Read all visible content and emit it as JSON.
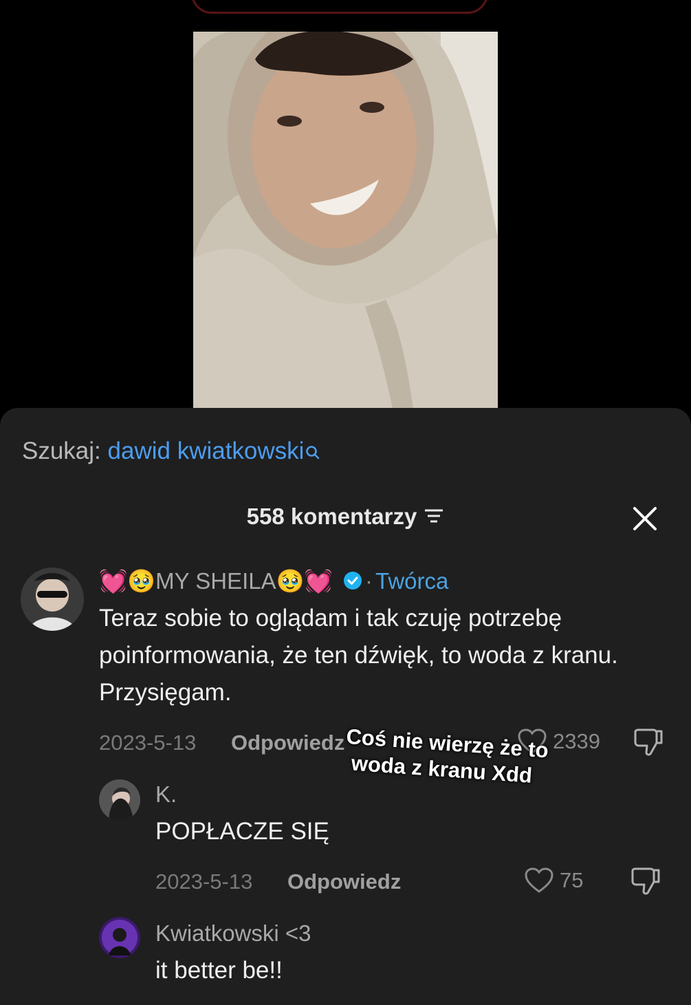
{
  "search": {
    "prefix": "Szukaj:",
    "query": "dawid kwiatkowski"
  },
  "comments_header": {
    "count_label": "558 komentarzy"
  },
  "overlay": {
    "line1": "Coś nie wierzę że to",
    "line2": "woda z kranu Xdd"
  },
  "comments": [
    {
      "username": "💓🥹MY SHEILA🥹💓",
      "creator_label": "Twórca",
      "text": "Teraz sobie to oglądam i tak czuję potrzebę poinformowania, że ten dźwięk, to woda z kranu. Przysięgam.",
      "date": "2023-5-13",
      "reply": "Odpowiedz",
      "likes": "2339"
    },
    {
      "username": "K.",
      "text": "POPŁACZE SIĘ",
      "date": "2023-5-13",
      "reply": "Odpowiedz",
      "likes": "75"
    },
    {
      "username": "Kwiatkowski <3",
      "text": "it better be!!"
    }
  ],
  "colors": {
    "accent_blue": "#4d9df0",
    "sheet_bg": "#1f1f1f",
    "verified": "#20b3f0"
  },
  "icons": [
    "search-icon",
    "filter-icon",
    "close-icon",
    "verified-icon",
    "heart-icon",
    "dislike-icon"
  ]
}
